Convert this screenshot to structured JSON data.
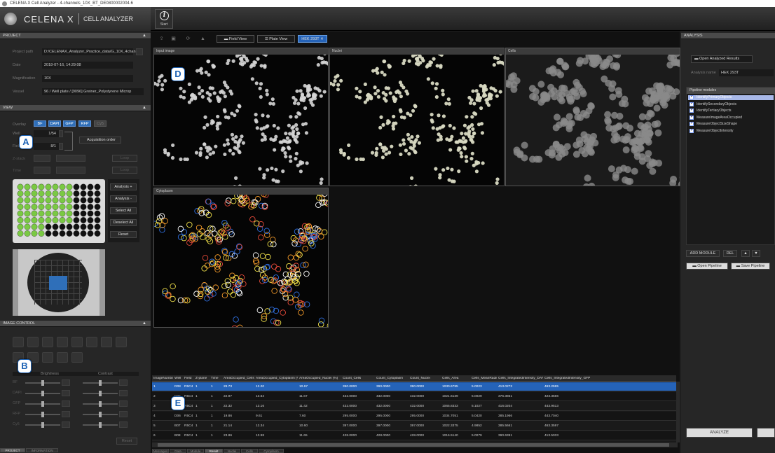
{
  "window_title": "CELENA X Cell Analyzer - 4-channels_10X_BT_DE0800002004.6",
  "app": {
    "brand": "CELENA X",
    "product": "CELL ANALYZER"
  },
  "toolbar": {
    "start_label": "Start"
  },
  "project": {
    "header": "PROJECT",
    "fields": [
      {
        "label": "Project path",
        "value": "D:/CELENAX_Analyzer_Practice_data/G_10X_4chan"
      },
      {
        "label": "Date",
        "value": "2018-07-16, 14:29:08"
      },
      {
        "label": "Magnification",
        "value": "10X"
      },
      {
        "label": "Vessel",
        "value": "96 / Well plate / [9096] Greiner_Polystyrene Microp"
      }
    ]
  },
  "view": {
    "header": "VIEW",
    "overlay_label": "Overlay",
    "channels": [
      "BF",
      "DAPI",
      "GFP",
      "RFP",
      "Cy5"
    ],
    "well_label": "Well",
    "field_label": "Field",
    "well_value": "1/54",
    "field_value": "8/1",
    "acquisition_order": "Acquisition order",
    "zstack_label": "Z-stack",
    "time_label": "Time",
    "loop_label": "Loop",
    "plate_buttons": [
      "Analysis +",
      "Analysis -",
      "Select All",
      "Deselect All",
      "Reset"
    ]
  },
  "image_control": {
    "header": "IMAGE CONTROL",
    "brightness": "Brightness",
    "contrast": "Contrast",
    "channels": [
      "BF",
      "DAPI",
      "GFP",
      "RFP",
      "Cy5"
    ],
    "reset": "Reset"
  },
  "left_tabs": [
    "PROJECT",
    "INFORMATION"
  ],
  "view_tabs": [
    "Field View",
    "Plate View",
    "HEK 293T"
  ],
  "images": [
    {
      "title": "Input image"
    },
    {
      "title": "Nuclei"
    },
    {
      "title": "Cells"
    },
    {
      "title": "Cytoplasm"
    }
  ],
  "badges": {
    "A": "A",
    "B": "B",
    "D": "D",
    "E": "E"
  },
  "analysis": {
    "header": "ANALYSIS",
    "open_results": "Open Analyzed Results",
    "analysis_name_label": "Analysis name",
    "analysis_name_value": "HEK 293T",
    "pipeline_header": "Pipeline modules",
    "modules": [
      "IdentifyPrimaryObjects",
      "IdentifySecondaryObjects",
      "IdentifyTertiaryObjects",
      "MeasureImageAreaOccupied",
      "MeasureObjectSizeShape",
      "MeasureObjectIntensity"
    ],
    "add_module": "ADD MODULE",
    "del": "DEL",
    "open_pipeline": "Open Pipeline",
    "save_pipeline": "Save Pipeline",
    "analyze": "ANALYZE"
  },
  "results": {
    "columns": [
      "ImageNumber",
      "Well",
      "Field",
      "Z-plane",
      "Time",
      "AreaOccupied_Cells (%)",
      "AreaOccupied_Cytoplasm (%)",
      "AreaOccupied_Nuclei (%)",
      "Count_Cells",
      "Count_Cytoplasm",
      "Count_Nuclei",
      "Cells_Area",
      "Cells_MeanRadius",
      "Cells_IntegratedIntensity_DAPI",
      "Cells_IntegratedIntensity_GFP"
    ],
    "rows": [
      [
        "1",
        "D08",
        "R5C4",
        "1",
        "1",
        "29.73",
        "12.20",
        "10.67",
        "390.0000",
        "390.0000",
        "390.0000",
        "1030.6795",
        "5.0023",
        "413.0273",
        "463.2595"
      ],
      [
        "2",
        "D05",
        "R5C4",
        "1",
        "1",
        "22.97",
        "13.64",
        "11.67",
        "432.0000",
        "432.0000",
        "432.0000",
        "1021.6139",
        "5.0029",
        "376.3851",
        "423.3566"
      ],
      [
        "3",
        "D06",
        "R5C4",
        "1",
        "1",
        "22.32",
        "13.16",
        "11.42",
        "432.0000",
        "432.0000",
        "432.0000",
        "1065.8333",
        "5.1027",
        "416.0204",
        "443.9513"
      ],
      [
        "4",
        "D06",
        "R5C4",
        "1",
        "1",
        "19.86",
        "9.61",
        "7.60",
        "295.0000",
        "295.0000",
        "295.0000",
        "1034.7051",
        "5.0420",
        "385.1966",
        "443.7040"
      ],
      [
        "5",
        "B07",
        "R5C4",
        "1",
        "1",
        "21.14",
        "12.34",
        "10.60",
        "397.0000",
        "397.0000",
        "397.0000",
        "1022.3375",
        "4.9852",
        "385.5661",
        "463.3597"
      ],
      [
        "6",
        "B08",
        "R5C4",
        "1",
        "1",
        "23.86",
        "13.98",
        "11.65",
        "428.0000",
        "428.0000",
        "428.0000",
        "1016.5140",
        "5.0079",
        "390.6391",
        "413.5033"
      ]
    ]
  },
  "bottom_tabs": [
    "Messages",
    "Data",
    "Module",
    "Result",
    "Nuclei",
    "Cells",
    "Cytoplasm"
  ],
  "colors": {
    "accent": "#2563b8",
    "well_selected": "#7ac943"
  }
}
